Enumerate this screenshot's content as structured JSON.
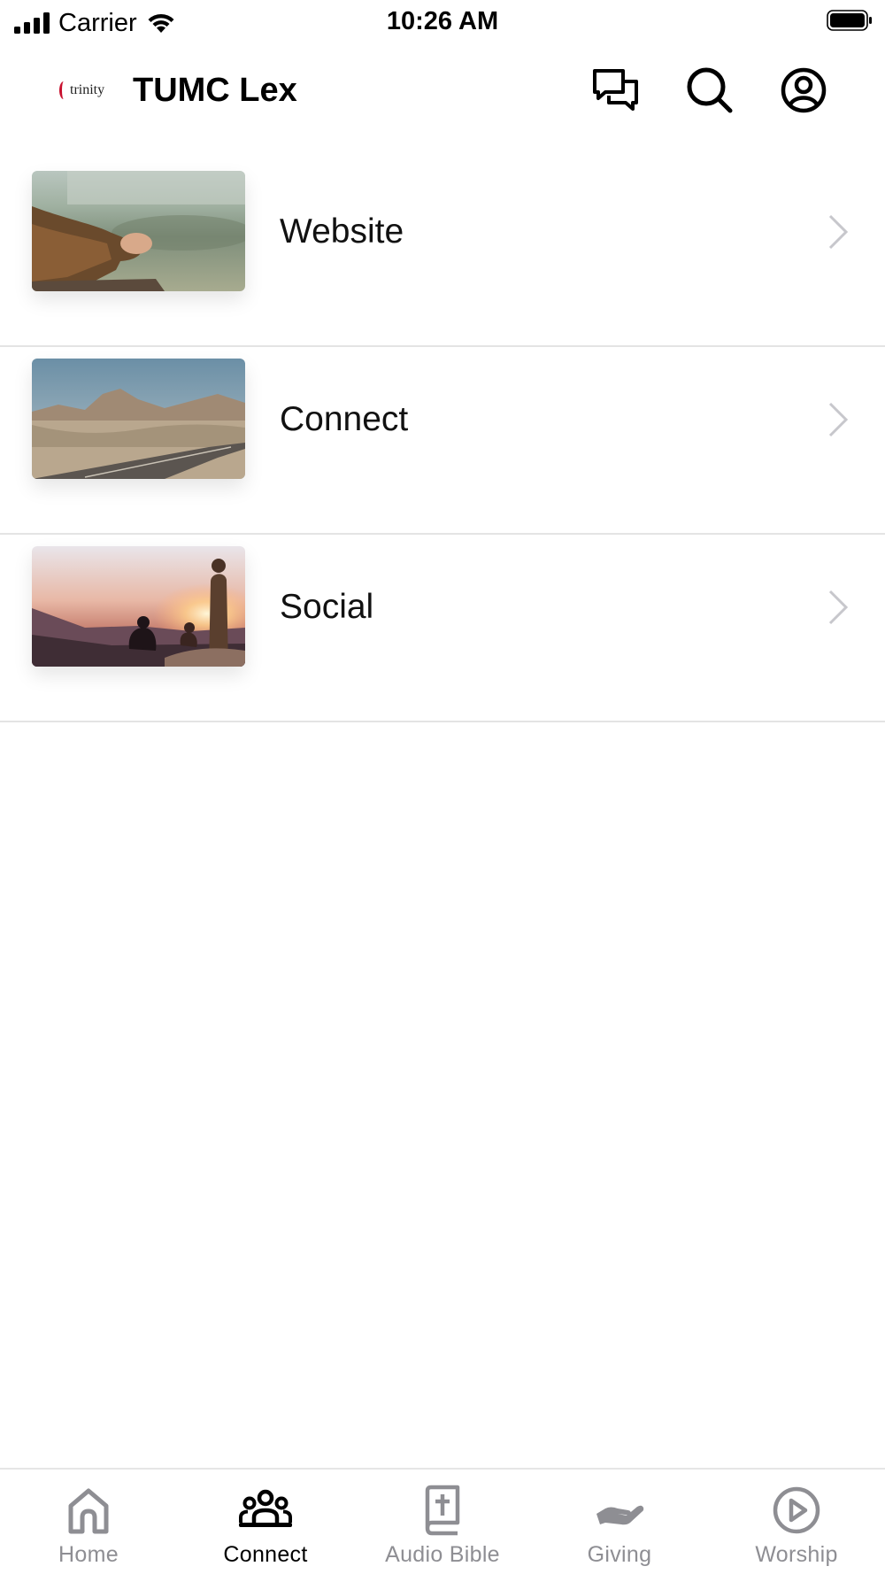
{
  "status_bar": {
    "carrier": "Carrier",
    "time": "10:26 AM"
  },
  "header": {
    "logo_text": "trinity",
    "title": "TUMC Lex",
    "icons": [
      "chat-icon",
      "search-icon",
      "profile-icon"
    ]
  },
  "menu": {
    "items": [
      {
        "label": "Website",
        "thumbnail": "hands-by-lake"
      },
      {
        "label": "Connect",
        "thumbnail": "desert-road"
      },
      {
        "label": "Social",
        "thumbnail": "sunset-hikers"
      }
    ]
  },
  "tabs": {
    "active": "Connect",
    "items": [
      {
        "label": "Home",
        "icon": "home-icon"
      },
      {
        "label": "Connect",
        "icon": "people-icon"
      },
      {
        "label": "Audio Bible",
        "icon": "bible-icon"
      },
      {
        "label": "Giving",
        "icon": "giving-hand-icon"
      },
      {
        "label": "Worship",
        "icon": "play-circle-icon"
      }
    ]
  },
  "colors": {
    "active_tab": "#000000",
    "inactive_tab": "#8e8e93",
    "divider": "#e4e4e4",
    "chevron": "#c7c7cc",
    "logo_accent": "#c8102e"
  }
}
